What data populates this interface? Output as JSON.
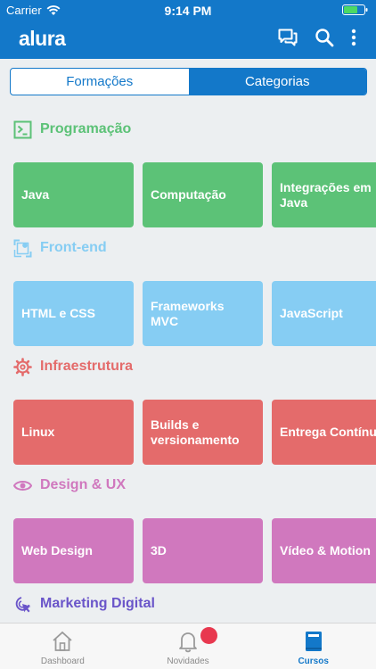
{
  "status": {
    "carrier": "Carrier",
    "time": "9:14 PM"
  },
  "app": {
    "brand": "alura"
  },
  "segments": {
    "first": "Formações",
    "second": "Categorias"
  },
  "colors": {
    "primary": "#1378c9",
    "programacao": "#5cc277",
    "frontend": "#86cdf3",
    "infra": "#e46b6b",
    "design": "#d078be",
    "marketing": "#6a55c9"
  },
  "sections": [
    {
      "name": "Programação",
      "icon": "terminal-icon",
      "color": "#5cc277",
      "tiles": [
        "Java",
        "Computação",
        "Integrações em Java"
      ]
    },
    {
      "name": "Front-end",
      "icon": "frontend-icon",
      "color": "#86cdf3",
      "tiles": [
        "HTML e CSS",
        "Frameworks MVC",
        "JavaScript"
      ]
    },
    {
      "name": "Infraestrutura",
      "icon": "gear-icon",
      "color": "#e46b6b",
      "tiles": [
        "Linux",
        "Builds e versionamento",
        "Entrega Contínua"
      ]
    },
    {
      "name": "Design & UX",
      "icon": "eye-icon",
      "color": "#d078be",
      "tiles": [
        "Web Design",
        "3D",
        "Vídeo & Motion"
      ]
    },
    {
      "name": "Marketing Digital",
      "icon": "cursor-click-icon",
      "color": "#6a55c9",
      "tiles": []
    }
  ],
  "tabs": [
    {
      "label": "Dashboard",
      "icon": "home-icon"
    },
    {
      "label": "Novidades",
      "icon": "bell-icon"
    },
    {
      "label": "Cursos",
      "icon": "book-icon"
    }
  ]
}
